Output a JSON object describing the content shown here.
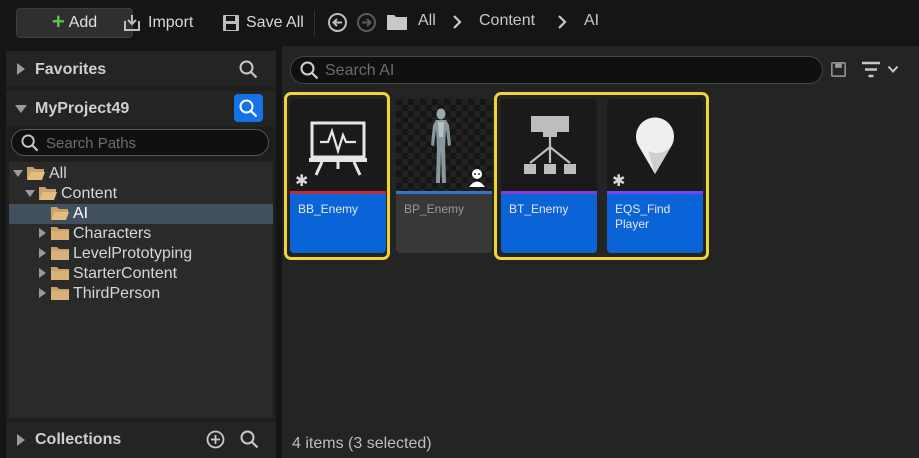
{
  "toolbar": {
    "add_label": "Add",
    "import_label": "Import",
    "save_all_label": "Save All",
    "breadcrumb": [
      "All",
      "Content",
      "AI"
    ]
  },
  "left_panel": {
    "favorites_title": "Favorites",
    "project_title": "MyProject49",
    "search_placeholder": "Search Paths",
    "tree": [
      {
        "label": "All",
        "depth": 0,
        "expanded": true
      },
      {
        "label": "Content",
        "depth": 1,
        "expanded": true
      },
      {
        "label": "AI",
        "depth": 2,
        "selected": true
      },
      {
        "label": "Characters",
        "depth": 2,
        "expanded": false
      },
      {
        "label": "LevelPrototyping",
        "depth": 2,
        "expanded": false
      },
      {
        "label": "StarterContent",
        "depth": 2,
        "expanded": false
      },
      {
        "label": "ThirdPerson",
        "depth": 2,
        "expanded": false
      }
    ],
    "collections_title": "Collections"
  },
  "content": {
    "search_placeholder": "Search AI",
    "assets": [
      {
        "name": "BB_Enemy",
        "icon": "blackboard-icon",
        "selected": true,
        "strip_color": "#c42a3d"
      },
      {
        "name": "BP_Enemy",
        "icon": "character-mannequin",
        "selected": false,
        "strip_color": "#3a73c8"
      },
      {
        "name": "BT_Enemy",
        "icon": "behavior-tree-icon",
        "selected": true,
        "strip_color": "#8a3ad4"
      },
      {
        "name": "EQS_Find Player",
        "icon": "map-pin-icon",
        "selected": true,
        "strip_color": "#7a42ff"
      }
    ],
    "status": "4 items (3 selected)"
  },
  "colors": {
    "selection_outline": "#f0d634",
    "selected_label_bg": "#0a64d8",
    "add_plus": "#5fc34d",
    "active_search_button": "#1473e6"
  }
}
